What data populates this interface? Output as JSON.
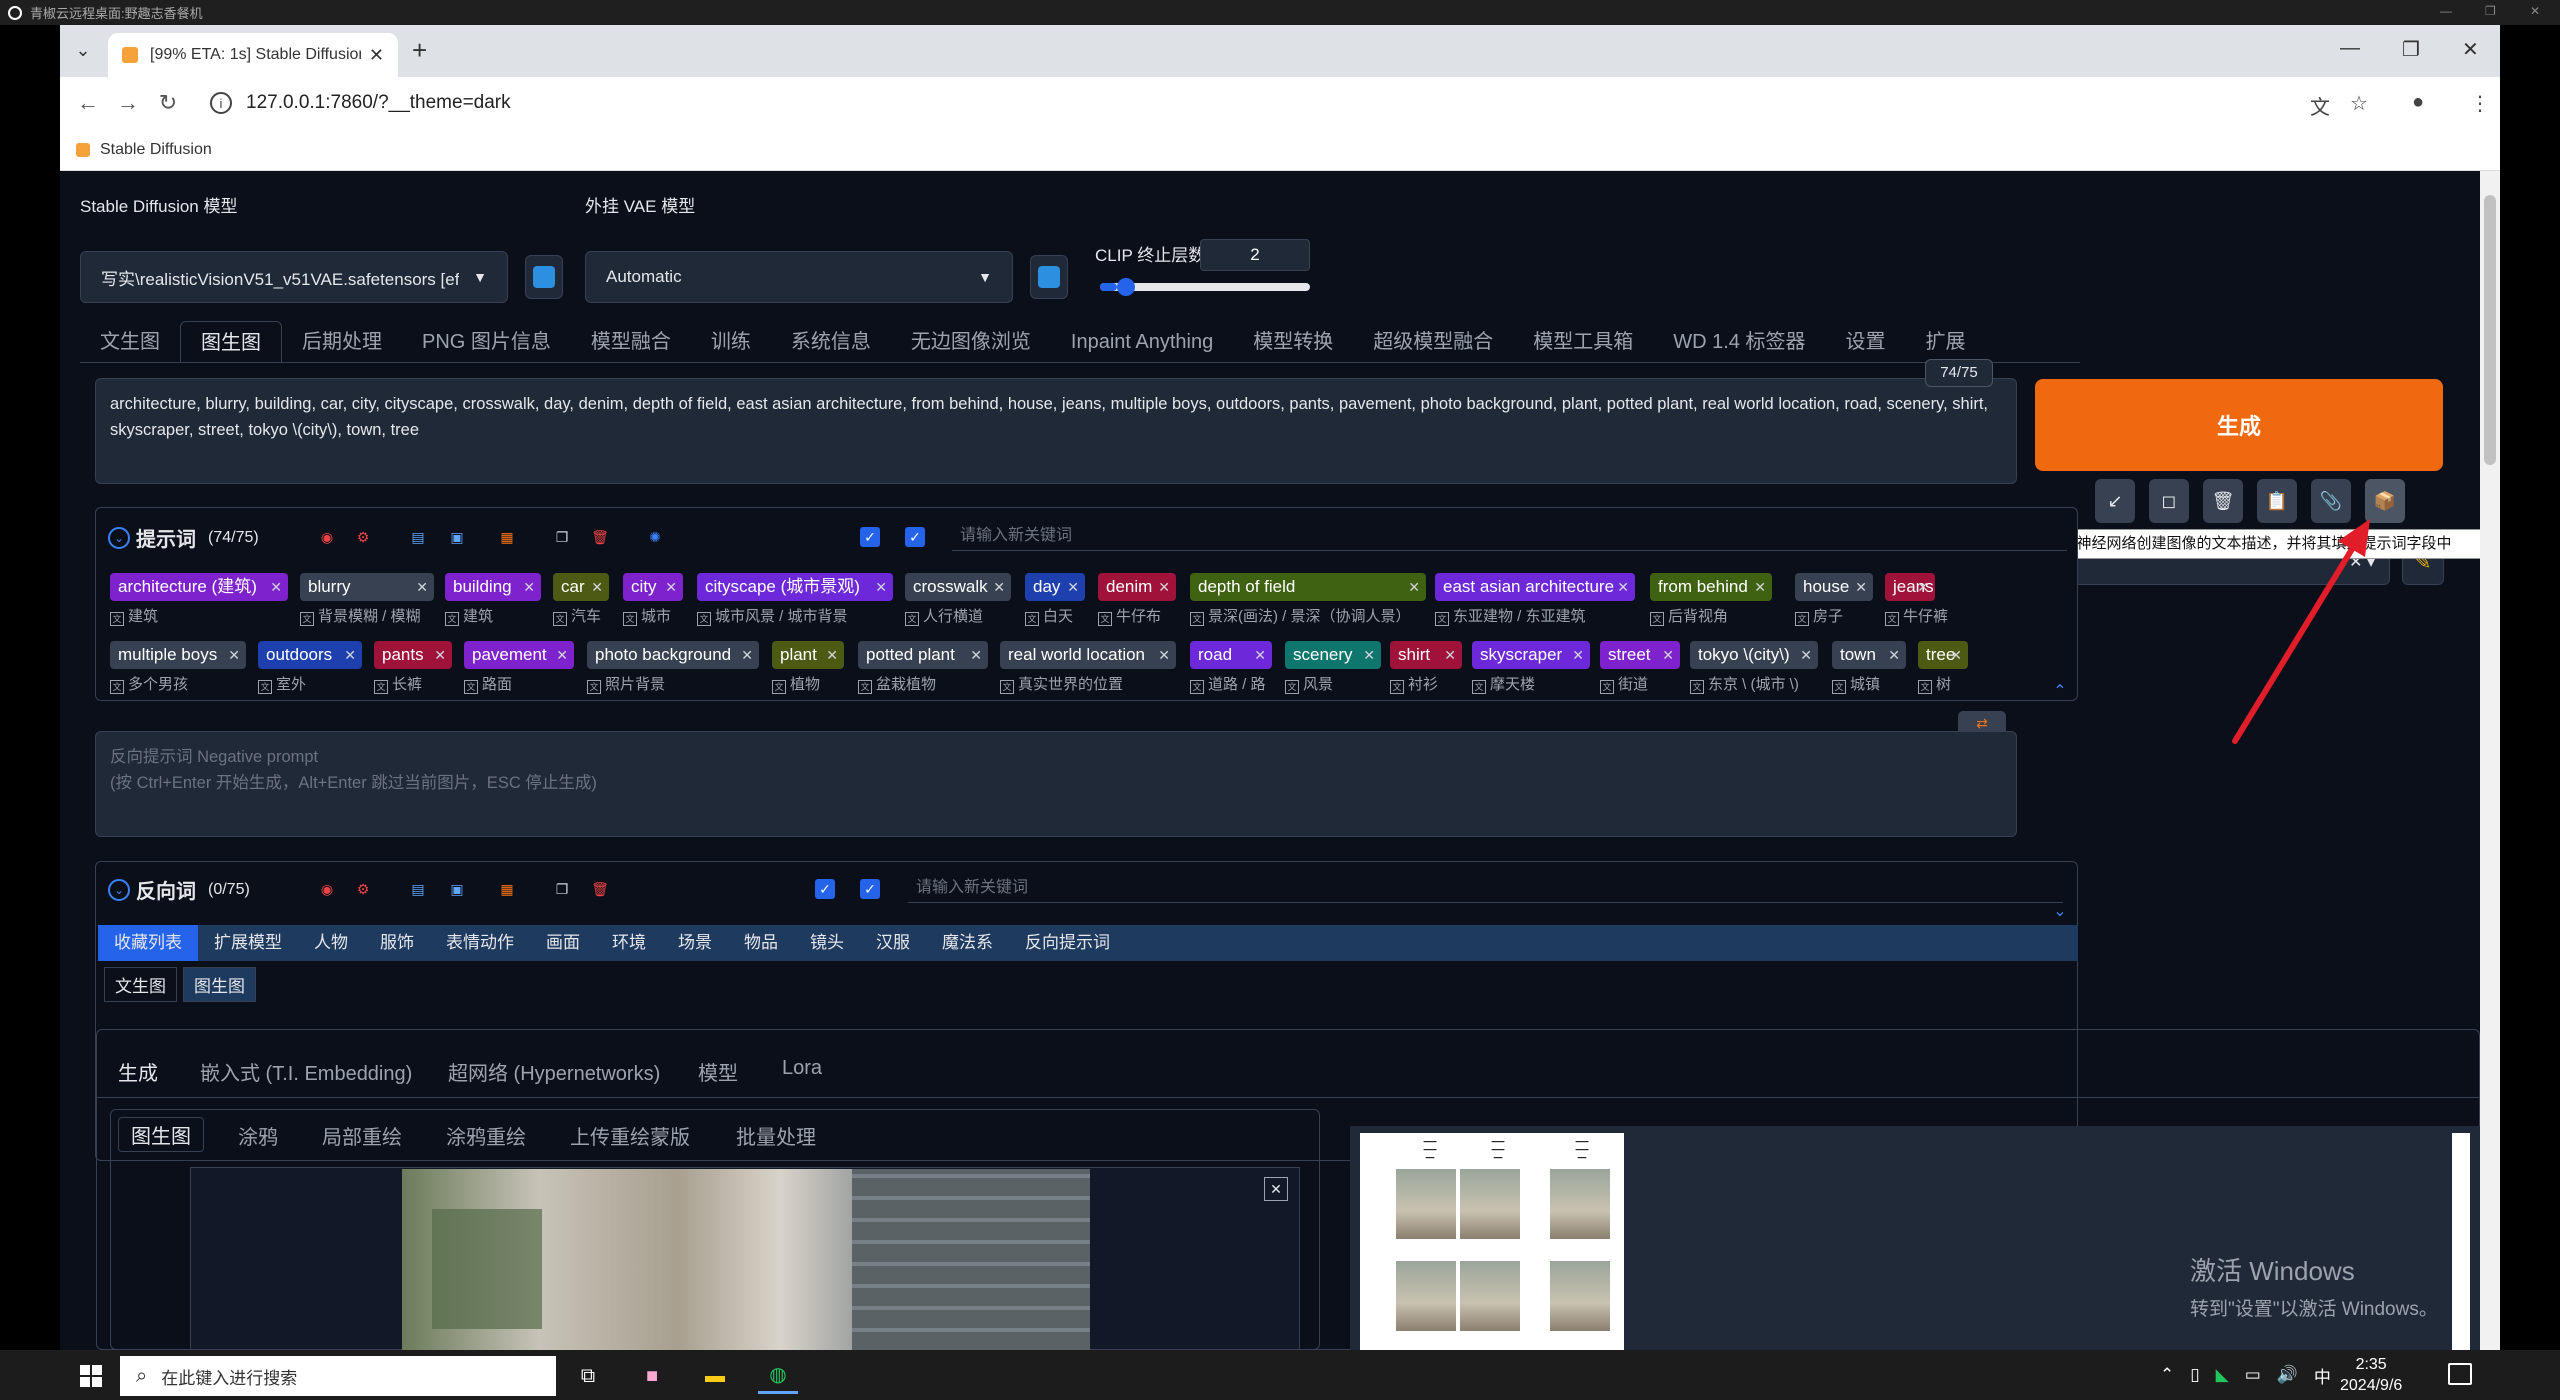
{
  "outer_title": "青椒云远程桌面:野趣志香餐机",
  "browser": {
    "tab_title": "[99% ETA: 1s] Stable Diffusion",
    "url": "127.0.0.1:7860/?__theme=dark",
    "bookmark": "Stable Diffusion"
  },
  "model": {
    "sd_label": "Stable Diffusion 模型",
    "sd_value": "写实\\realisticVisionV51_v51VAE.safetensors [ef",
    "vae_label": "外挂 VAE 模型",
    "vae_value": "Automatic",
    "clip_label": "CLIP 终止层数",
    "clip_value": "2",
    "clip_slider_fraction": 0.08
  },
  "main_tabs": [
    "文生图",
    "图生图",
    "后期处理",
    "PNG 图片信息",
    "模型融合",
    "训练",
    "系统信息",
    "无边图像浏览",
    "Inpaint Anything",
    "模型转换",
    "超级模型融合",
    "模型工具箱",
    "WD 1.4 标签器",
    "设置",
    "扩展"
  ],
  "prompt": {
    "text": "architecture, blurry, building, car, city, cityscape, crosswalk, day, denim, depth of field, east asian architecture, from behind, house, jeans, multiple boys, outdoors, pants, pavement, photo background, plant, potted plant, real world location, road, scenery, shirt, skyscraper, street, tokyo \\(city\\), town, tree",
    "token_count": "74/75",
    "header_title": "提示词",
    "header_count": "(74/75)",
    "keyword_placeholder": "请输入新关键词"
  },
  "tags_row1": [
    {
      "en": "architecture (建筑)",
      "zh": "建筑",
      "color": "purple"
    },
    {
      "en": "blurry",
      "zh": "背景模糊 / 模糊",
      "color": "gray"
    },
    {
      "en": "building",
      "zh": "建筑",
      "color": "purple"
    },
    {
      "en": "car",
      "zh": "汽车",
      "color": "olive"
    },
    {
      "en": "city",
      "zh": "城市",
      "color": "purple"
    },
    {
      "en": "cityscape (城市景观)",
      "zh": "城市风景 / 城市背景",
      "color": "violet"
    },
    {
      "en": "crosswalk",
      "zh": "人行横道",
      "color": "gray"
    },
    {
      "en": "day",
      "zh": "白天",
      "color": "blue"
    },
    {
      "en": "denim",
      "zh": "牛仔布",
      "color": "red"
    },
    {
      "en": "depth of field",
      "zh": "景深(画法) / 景深（协调人景）",
      "color": "green"
    },
    {
      "en": "east asian architecture",
      "zh": "东亚建物 / 东亚建筑",
      "color": "violet"
    },
    {
      "en": "from behind",
      "zh": "后背视角",
      "color": "green"
    },
    {
      "en": "house",
      "zh": "房子",
      "color": "gray"
    },
    {
      "en": "jeans",
      "zh": "牛仔裤",
      "color": "red"
    }
  ],
  "tags_row2": [
    {
      "en": "multiple boys",
      "zh": "多个男孩",
      "color": "gray"
    },
    {
      "en": "outdoors",
      "zh": "室外",
      "color": "blue"
    },
    {
      "en": "pants",
      "zh": "长裤",
      "color": "red"
    },
    {
      "en": "pavement",
      "zh": "路面",
      "color": "purple"
    },
    {
      "en": "photo background",
      "zh": "照片背景",
      "color": "gray"
    },
    {
      "en": "plant",
      "zh": "植物",
      "color": "olive"
    },
    {
      "en": "potted plant",
      "zh": "盆栽植物",
      "color": "gray"
    },
    {
      "en": "real world location",
      "zh": "真实世界的位置",
      "color": "gray"
    },
    {
      "en": "road",
      "zh": "道路 / 路",
      "color": "violet"
    },
    {
      "en": "scenery",
      "zh": "风景",
      "color": "teal"
    },
    {
      "en": "shirt",
      "zh": "衬衫",
      "color": "red"
    },
    {
      "en": "skyscraper",
      "zh": "摩天楼",
      "color": "violet"
    },
    {
      "en": "street",
      "zh": "街道",
      "color": "purple"
    },
    {
      "en": "tokyo \\(city\\)",
      "zh": "东京 \\ (城市 \\)",
      "color": "gray"
    },
    {
      "en": "town",
      "zh": "城镇",
      "color": "gray"
    },
    {
      "en": "tree",
      "zh": "树",
      "color": "olive"
    }
  ],
  "negative": {
    "placeholder": "反向提示词 Negative prompt\n(按 Ctrl+Enter 开始生成，Alt+Enter 跳过当前图片，ESC 停止生成)",
    "header_title": "反向词",
    "header_count": "(0/75)",
    "keyword_placeholder": "请输入新关键词"
  },
  "categories": [
    "收藏列表",
    "扩展模型",
    "人物",
    "服饰",
    "表情动作",
    "画面",
    "环境",
    "场景",
    "物品",
    "镜头",
    "汉服",
    "魔法系",
    "反向提示词"
  ],
  "sub_categories": [
    "文生图",
    "图生图"
  ],
  "generate_label": "生成",
  "tooltip": "DeepBooru - 使用 DeepBooru 神经网络创建图像的文本描述，并将其填入提示词字段中",
  "bottom_tabs": [
    "生成",
    "嵌入式 (T.I. Embedding)",
    "超网络 (Hypernetworks)",
    "模型",
    "Lora"
  ],
  "img2img_tabs": [
    "图生图",
    "涂鸦",
    "局部重绘",
    "涂鸦重绘",
    "上传重绘蒙版",
    "批量处理"
  ],
  "watermark": {
    "line1": "激活 Windows",
    "line2": "转到\"设置\"以激活 Windows。"
  },
  "taskbar": {
    "search_placeholder": "在此键入进行搜索",
    "time": "2:35",
    "date": "2024/9/6",
    "ime": "中"
  },
  "colors": {
    "purple": "#7e22ce",
    "gray": "#374151",
    "red": "#9f1239",
    "green": "#3f6212",
    "blue": "#1e40af",
    "teal": "#0f766e",
    "olive": "#4d5a14",
    "violet": "#6d28d9",
    "accent": "#f0690f"
  }
}
